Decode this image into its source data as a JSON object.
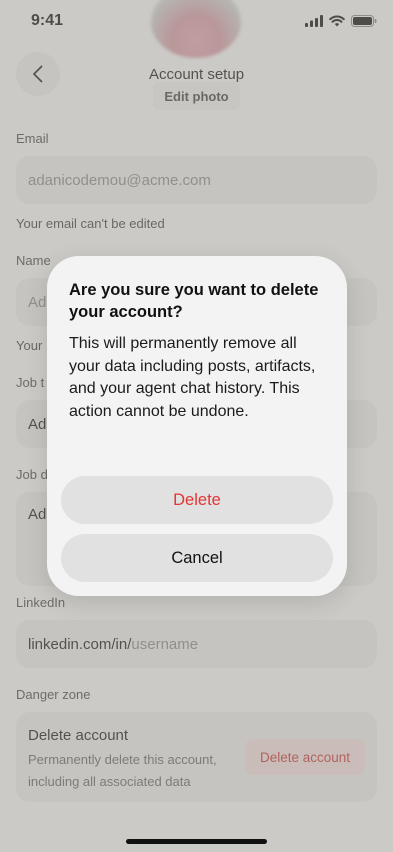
{
  "status_bar": {
    "time": "9:41"
  },
  "header": {
    "title": "Account setup",
    "edit_photo": "Edit photo"
  },
  "email": {
    "label": "Email",
    "value": "adanicodemou@acme.com",
    "helper": "Your email can't be edited"
  },
  "name": {
    "label": "Name",
    "value": "Ad"
  },
  "name_helper": "Your",
  "job_title": {
    "label": "Job t",
    "value": "Ad"
  },
  "job_description": {
    "label": "Job d",
    "value": "Ad"
  },
  "linkedin": {
    "label": "LinkedIn",
    "prefix": "linkedin.com/in/",
    "placeholder": "username"
  },
  "danger_zone": {
    "label": "Danger zone",
    "title": "Delete account",
    "description": "Permanently delete this account, including all associated data",
    "button": "Delete account"
  },
  "dialog": {
    "title": "Are you sure you want to delete your account?",
    "body": "This will permanently remove all your data including posts, artifacts, and your agent chat history. This action cannot be undone.",
    "confirm": "Delete",
    "cancel": "Cancel"
  },
  "colors": {
    "destructive": "#e33535",
    "danger_button_bg": "#f4dede",
    "scrim": "rgba(150,148,140,0.45)"
  },
  "icons": [
    "cellular-signal-icon",
    "wifi-icon",
    "battery-icon",
    "chevron-left-icon"
  ]
}
